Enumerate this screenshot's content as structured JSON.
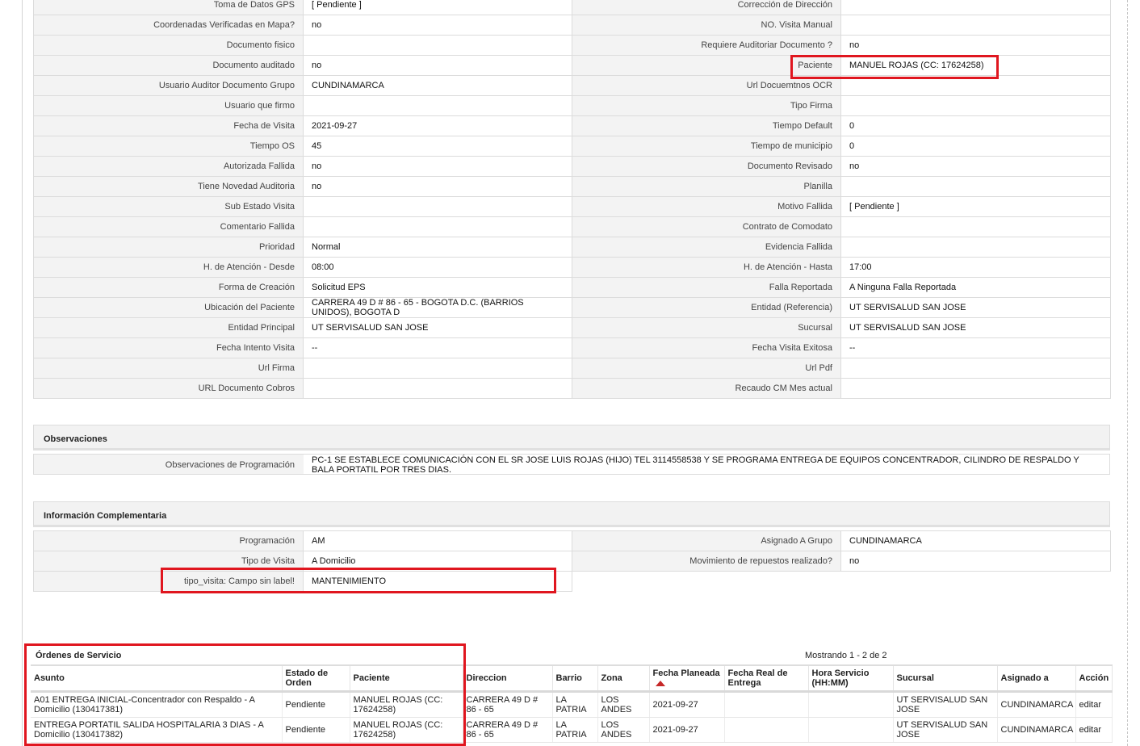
{
  "details": [
    [
      "Toma de Datos GPS",
      "[ Pendiente ]",
      "Corrección de Dirección",
      ""
    ],
    [
      "Coordenadas Verificadas en Mapa?",
      "no",
      "NO. Visita Manual",
      ""
    ],
    [
      "Documento fisico",
      "",
      "Requiere Auditoriar Documento ?",
      "no"
    ],
    [
      "Documento auditado",
      "no",
      "Paciente",
      "MANUEL ROJAS (CC: 17624258)"
    ],
    [
      "Usuario Auditor Documento Grupo",
      "CUNDINAMARCA",
      "Url Docuemtnos OCR",
      ""
    ],
    [
      "Usuario que firmo",
      "",
      "Tipo Firma",
      ""
    ],
    [
      "Fecha de Visita",
      "2021-09-27",
      "Tiempo Default",
      "0"
    ],
    [
      "Tiempo OS",
      "45",
      "Tiempo de municipio",
      "0"
    ],
    [
      "Autorizada Fallida",
      "no",
      "Documento Revisado",
      "no"
    ],
    [
      "Tiene Novedad Auditoria",
      "no",
      "Planilla",
      ""
    ],
    [
      "Sub Estado Visita",
      "",
      "Motivo Fallida",
      "[ Pendiente ]"
    ],
    [
      "Comentario Fallida",
      "",
      "Contrato de Comodato",
      ""
    ],
    [
      "Prioridad",
      "Normal",
      "Evidencia Fallida",
      ""
    ],
    [
      "H. de Atención - Desde",
      "08:00",
      "H. de Atención - Hasta",
      "17:00"
    ],
    [
      "Forma de Creación",
      "Solicitud EPS",
      "Falla Reportada",
      "A Ninguna Falla Reportada"
    ],
    [
      "Ubicación del Paciente",
      "CARRERA 49 D # 86 - 65 - BOGOTA D.C. (BARRIOS UNIDOS), BOGOTA D",
      "Entidad (Referencia)",
      "UT SERVISALUD SAN JOSE"
    ],
    [
      "Entidad Principal",
      "UT SERVISALUD SAN JOSE",
      "Sucursal",
      "UT SERVISALUD SAN JOSE"
    ],
    [
      "Fecha Intento Visita",
      "--",
      "Fecha Visita Exitosa",
      "--"
    ],
    [
      "Url Firma",
      "",
      "Url Pdf",
      ""
    ],
    [
      "URL Documento Cobros",
      "",
      "Recaudo CM Mes actual",
      ""
    ]
  ],
  "observaciones": {
    "title": "Observaciones",
    "label": "Observaciones de Programación",
    "value": "PC-1 SE ESTABLECE COMUNICACIÓN CON EL SR JOSE LUIS ROJAS (HIJO) TEL 3114558538 Y SE PROGRAMA ENTREGA DE EQUIPOS CONCENTRADOR, CILINDRO DE RESPALDO Y BALA PORTATIL POR TRES DIAS."
  },
  "complementaria": {
    "title": "Información Complementaria",
    "rows": [
      [
        "Programación",
        "AM",
        "Asignado A Grupo",
        "CUNDINAMARCA"
      ],
      [
        "Tipo de Visita",
        "A Domicilio",
        "Movimiento de repuestos realizado?",
        "no"
      ],
      [
        "tipo_visita: Campo sin label!",
        "MANTENIMIENTO",
        null,
        null
      ]
    ]
  },
  "ordenes": {
    "title": "Órdenes de Servicio",
    "showing": "Mostrando 1 - 2 de 2",
    "columns": [
      "Asunto",
      "Estado de Orden",
      "Paciente",
      "Direccion",
      "Barrio",
      "Zona",
      "Fecha Planeada",
      "Fecha Real de Entrega",
      "Hora Servicio (HH:MM)",
      "Sucursal",
      "Asignado a",
      "Acción"
    ],
    "rows": [
      [
        "A01 ENTREGA INICIAL-Concentrador con Respaldo - A Domicilio (130417381)",
        "Pendiente",
        "MANUEL ROJAS (CC: 17624258)",
        "CARRERA 49 D # 86 - 65",
        "LA PATRIA",
        "LOS ANDES",
        "2021-09-27",
        "",
        "",
        "UT SERVISALUD SAN JOSE",
        "CUNDINAMARCA",
        "editar"
      ],
      [
        "ENTREGA PORTATIL SALIDA HOSPITALARIA 3 DIAS - A Domicilio (130417382)",
        "Pendiente",
        "MANUEL ROJAS (CC: 17624258)",
        "CARRERA 49 D # 86 - 65",
        "LA PATRIA",
        "LOS ANDES",
        "2021-09-27",
        "",
        "",
        "UT SERVISALUD SAN JOSE",
        "CUNDINAMARCA",
        "editar"
      ]
    ]
  },
  "colors": {
    "highlight": "#e0161f",
    "sort_arrow": "#c62828"
  }
}
